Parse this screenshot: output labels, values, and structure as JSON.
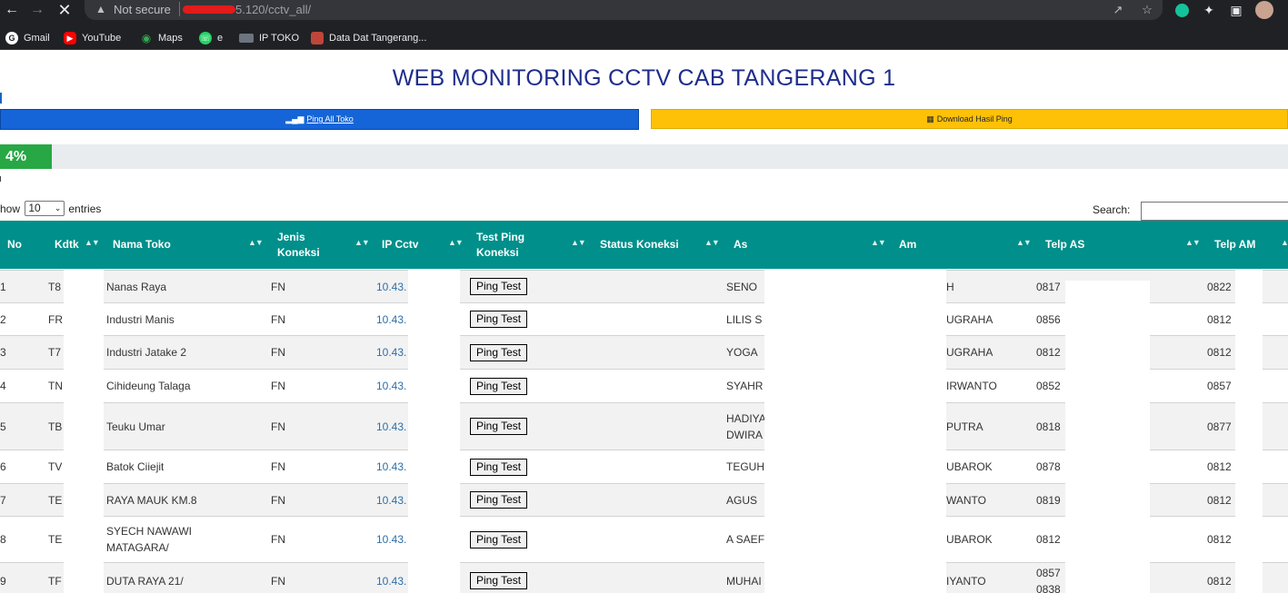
{
  "browser": {
    "security_label": "Not secure",
    "url_suffix": "5.120/cctv_all/",
    "bookmarks": [
      "Gmail",
      "YouTube",
      "Maps",
      "e",
      "IP TOKO",
      "Data Dat Tangerang..."
    ]
  },
  "page": {
    "title": "WEB MONITORING CCTV CAB TANGERANG 1",
    "ping_all_label": "Ping All Toko",
    "download_label": "Download Hasil Ping",
    "progress_label": "4%",
    "progress_percent": 4,
    "show_prefix": "how",
    "show_value": "10",
    "show_suffix": "entries",
    "search_label": "Search:"
  },
  "table": {
    "headers": {
      "no": "No",
      "kdtk": "Kdtk",
      "nama_toko": "Nama Toko",
      "jenis_1": "Jenis",
      "jenis_2": "Koneksi",
      "ip_cctv": "IP Cctv",
      "test_1": "Test Ping",
      "test_2": "Koneksi",
      "status": "Status Koneksi",
      "as": "As",
      "am": "Am",
      "telp_as": "Telp AS",
      "telp_am": "Telp AM"
    },
    "rows": [
      {
        "no": "1",
        "kdtk": "T8",
        "nama": "Nanas Raya",
        "nama2": "",
        "jenis": "FN",
        "ip": "10.43.",
        "ping": "Ping Test",
        "as": "SENO",
        "as2": "",
        "am": "H",
        "am2": "",
        "telp_as": "0817",
        "telp_as2": "",
        "telp_am": "0822"
      },
      {
        "no": "2",
        "kdtk": "FR",
        "nama": "Industri Manis",
        "nama2": "",
        "jenis": "FN",
        "ip": "10.43.",
        "ping": "Ping Test",
        "as": "LILIS S",
        "as2": "",
        "am": "UGRAHA",
        "am2": "",
        "telp_as": "0856",
        "telp_as2": "",
        "telp_am": "0812"
      },
      {
        "no": "3",
        "kdtk": "T7",
        "nama": "Industri Jatake 2",
        "nama2": "",
        "jenis": "FN",
        "ip": "10.43.",
        "ping": "Ping Test",
        "as": "YOGA",
        "as2": "",
        "am": "UGRAHA",
        "am2": "",
        "telp_as": "0812",
        "telp_as2": "",
        "telp_am": "0812"
      },
      {
        "no": "4",
        "kdtk": "TN",
        "nama": "Cihideung Talaga",
        "nama2": "",
        "jenis": "FN",
        "ip": "10.43.",
        "ping": "Ping Test",
        "as": "SYAHR",
        "as2": "",
        "am": "IRWANTO",
        "am2": "",
        "telp_as": "0852",
        "telp_as2": "",
        "telp_am": "0857"
      },
      {
        "no": "5",
        "kdtk": "TB",
        "nama": "Teuku Umar",
        "nama2": "",
        "jenis": "FN",
        "ip": "10.43.",
        "ping": "Ping Test",
        "as": "HADIYA",
        "as2": "DWIRA",
        "am": "PUTRA",
        "am2": "",
        "telp_as": "0818",
        "telp_as2": "",
        "telp_am": "0877"
      },
      {
        "no": "6",
        "kdtk": "TV",
        "nama": "Batok Ciiejit",
        "nama2": "",
        "jenis": "FN",
        "ip": "10.43.",
        "ping": "Ping Test",
        "as": "TEGUH",
        "as2": "",
        "am": "UBAROK",
        "am2": "",
        "telp_as": "0878",
        "telp_as2": "",
        "telp_am": "0812"
      },
      {
        "no": "7",
        "kdtk": "TE",
        "nama": "RAYA MAUK KM.8",
        "nama2": "",
        "jenis": "FN",
        "ip": "10.43.",
        "ping": "Ping Test",
        "as": "AGUS",
        "as2": "",
        "am": "WANTO",
        "am2": "",
        "telp_as": "0819",
        "telp_as2": "",
        "telp_am": "0812"
      },
      {
        "no": "8",
        "kdtk": "TE",
        "nama": "SYECH NAWAWI",
        "nama2": "MATAGARA/",
        "jenis": "FN",
        "ip": "10.43.",
        "ping": "Ping Test",
        "as": "A SAEF",
        "as2": "",
        "am": "UBAROK",
        "am2": "",
        "telp_as": "0812",
        "telp_as2": "",
        "telp_am": "0812"
      },
      {
        "no": "9",
        "kdtk": "TF",
        "nama": "DUTA RAYA 21/",
        "nama2": "",
        "jenis": "FN",
        "ip": "10.43.",
        "ping": "Ping Test",
        "as": "MUHAI",
        "as2": "",
        "am": "IYANTO",
        "am2": "",
        "telp_as": "0857",
        "telp_as2": "0838",
        "telp_am": "0812"
      }
    ]
  },
  "colors": {
    "title": "#1e2d8c",
    "header_bg": "#008f8a",
    "ping_all_bg": "#1565d8",
    "download_bg": "#ffc107",
    "progress_fill": "#28a745",
    "ip_link": "#2e6fa8"
  },
  "icons": [
    "back-arrow-icon",
    "forward-arrow-icon",
    "stop-icon",
    "warning-icon",
    "share-icon",
    "star-icon",
    "grammarly-icon",
    "puzzle-icon",
    "side-panel-icon",
    "avatar-icon",
    "signal-bars-icon",
    "file-excel-icon",
    "sort-icon",
    "chevron-down-icon"
  ]
}
